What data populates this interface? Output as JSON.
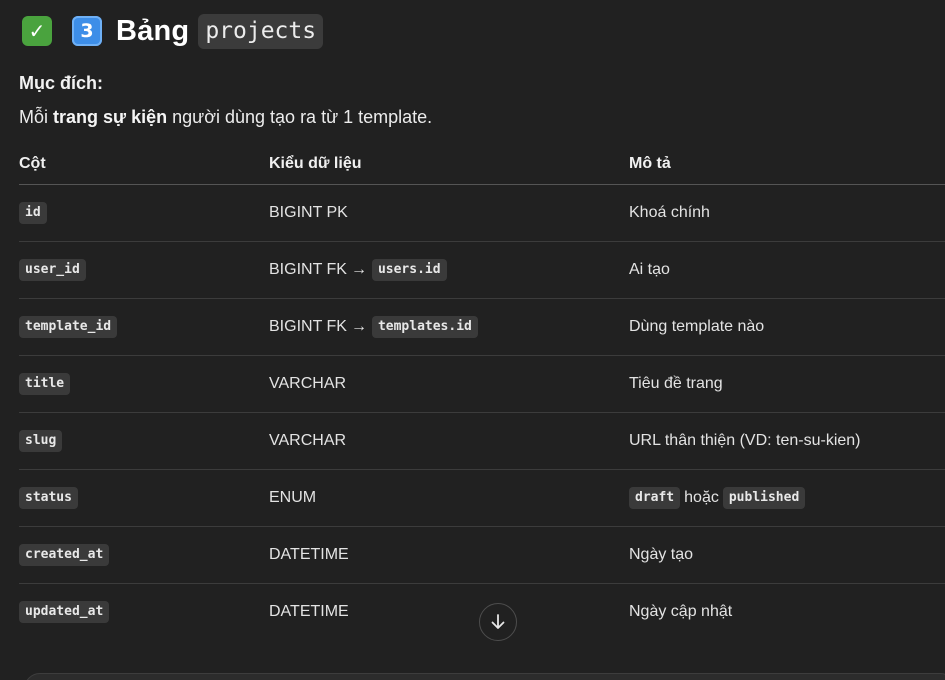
{
  "heading": {
    "check_emoji": "✓",
    "number_emoji": "3",
    "word": "Bảng",
    "code": "projects"
  },
  "purpose": {
    "label": "Mục đích:",
    "prefix": "Mỗi",
    "bold": "trang sự kiện",
    "suffix": "người dùng tạo ra từ 1 template."
  },
  "table": {
    "headers": [
      "Cột",
      "Kiểu dữ liệu",
      "Mô tả"
    ],
    "rows": [
      {
        "column": "id",
        "type": "BIGINT PK",
        "description": "Khoá chính"
      },
      {
        "column": "user_id",
        "type": "BIGINT FK",
        "type_arrow": "→",
        "type_ref": "users.id",
        "description": "Ai tạo"
      },
      {
        "column": "template_id",
        "type": "BIGINT FK",
        "type_arrow": "→",
        "type_ref": "templates.id",
        "description": "Dùng template nào"
      },
      {
        "column": "title",
        "type": "VARCHAR",
        "description": "Tiêu đề trang"
      },
      {
        "column": "slug",
        "type": "VARCHAR",
        "description": "URL thân thiện (VD: ten-su-kien)"
      },
      {
        "column": "status",
        "type": "ENUM",
        "desc_code_1": "draft",
        "desc_word": "hoặc",
        "desc_code_2": "published"
      },
      {
        "column": "created_at",
        "type": "DATETIME",
        "description": "Ngày tạo"
      },
      {
        "column": "updated_at",
        "type": "DATETIME",
        "description": "Ngày cập nhật"
      }
    ]
  },
  "icons": {
    "scroll_down": "arrow-down-icon",
    "check": "check-mark-icon",
    "keycap": "keycap-3-icon"
  },
  "colors": {
    "background": "#212121",
    "check_green": "#4aa33e",
    "keycap_blue": "#3d8ee8",
    "code_bg": "#3a3a3a"
  }
}
